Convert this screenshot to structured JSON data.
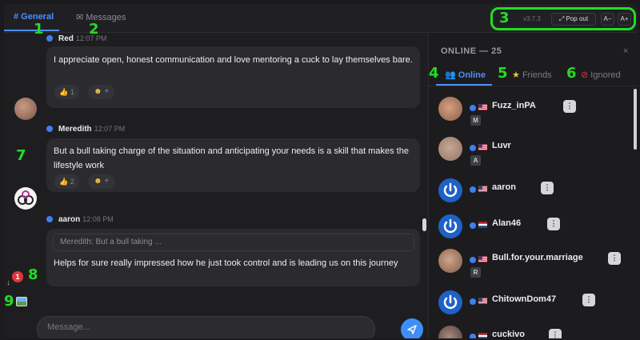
{
  "tabs": {
    "general": "# General",
    "messages": "✉ Messages"
  },
  "toolbar": {
    "version": "v3.7.3",
    "popout": "⤢ Pop out",
    "font_down": "A−",
    "font_up": "A+"
  },
  "annotations": [
    "1",
    "2",
    "3",
    "4",
    "5",
    "6",
    "7",
    "8",
    "9"
  ],
  "messages": [
    {
      "author": "Red",
      "time": "12:07 PM",
      "text": "I appreciate open, honest communication and love mentoring a cuck to lay themselves bare.",
      "reaction": "👍",
      "reaction_count": "1",
      "add_reaction": "+"
    },
    {
      "author": "Meredith",
      "time": "12:07 PM",
      "text": "But a bull taking charge of the situation and anticipating your needs is a skill that makes the lifestyle work",
      "reaction": "👍",
      "reaction_count": "2",
      "add_reaction": "+"
    },
    {
      "author": "aaron",
      "time": "12:08 PM",
      "quote": "Meredith: But a bull taking ...",
      "text": "Helps for sure really impressed how he just took control and is leading us on this journey"
    }
  ],
  "jump_badge": "1",
  "composer": {
    "placeholder": "Message..."
  },
  "sidebar": {
    "title": "ONLINE — 25",
    "close": "×",
    "tabs": {
      "online": "Online",
      "friends": "Friends",
      "ignored": "Ignored"
    },
    "users": [
      {
        "name": "Fuzz_inPA",
        "flag": "us",
        "tag": "M"
      },
      {
        "name": "Luvr",
        "flag": "us",
        "tag": "A"
      },
      {
        "name": "aaron",
        "flag": "us",
        "tag": ""
      },
      {
        "name": "Alan46",
        "flag": "nl",
        "tag": ""
      },
      {
        "name": "Bull.for.your.marriage",
        "flag": "us",
        "tag": "R"
      },
      {
        "name": "ChitownDom47",
        "flag": "us",
        "tag": ""
      },
      {
        "name": "cuckivo",
        "flag": "nl",
        "tag": ""
      }
    ],
    "user_menu": "⋮"
  }
}
